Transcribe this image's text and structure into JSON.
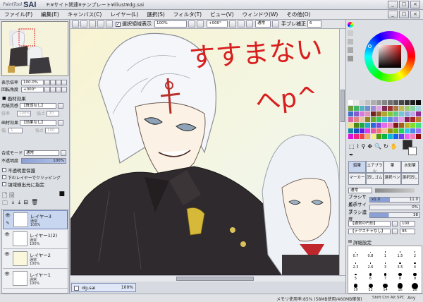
{
  "app": {
    "logo_small": "PaintTool",
    "logo_big": "SAI",
    "title": "F:¥サイト関連¥テンプレート¥illust¥dg.sai"
  },
  "window_buttons": [
    "_",
    "□",
    "×"
  ],
  "menu": [
    "ファイル(F)",
    "編集(E)",
    "キャンバス(C)",
    "レイヤー(L)",
    "選択(S)",
    "フィルタ(T)",
    "ビュー(V)",
    "ウィンドウ(W)",
    "その他(O)"
  ],
  "toolbar": {
    "selection_label": "選択領域表示",
    "zoom": "100%",
    "angle": "+000°",
    "mode": "通常",
    "stabilizer_label": "手ブレ補正",
    "stabilizer_value": "6"
  },
  "navigator": {
    "zoom_label": "表示倍率",
    "zoom_value": "100.0%",
    "rotate_label": "回転角度",
    "rotate_value": "+000°"
  },
  "paper": {
    "header": "画材効果",
    "texture_label": "用紙質感",
    "texture_value": "【質感なし】",
    "scale_label": "倍率",
    "scale_value": "100%",
    "strength_label": "強さ",
    "strength_value": "20",
    "effect_label": "画材効果",
    "effect_value": "【効果なし】",
    "width_label": "幅",
    "width_value": "1",
    "intensity_label": "強さ",
    "intensity_value": "100"
  },
  "layer_props": {
    "blend_label": "合成モード",
    "blend_value": "通常",
    "opacity_label": "不透明度",
    "opacity_value": "100%",
    "checks": [
      "不透明度保護",
      "下のレイヤーでクリッピング",
      "領域検出元に指定"
    ]
  },
  "layers": [
    {
      "name": "レイヤー3",
      "mode": "通常",
      "opacity": "100%"
    },
    {
      "name": "レイヤー1(2)",
      "mode": "通常",
      "opacity": "100%"
    },
    {
      "name": "レイヤー2",
      "mode": "通常",
      "opacity": "100%"
    },
    {
      "name": "レイヤー1",
      "mode": "通常",
      "opacity": "100%"
    }
  ],
  "canvas": {
    "handwriting_line1": "すすまない",
    "handwriting_line2": "へp^"
  },
  "doc_tab": {
    "name": "dg.sai",
    "zoom": "100%"
  },
  "status": {
    "memory": "メモリ使用率:85% (58MB使用/460MB確保)",
    "keys": "Shift Ctrl Alt SPC",
    "brand": "Any"
  },
  "tools": {
    "tabs": [
      "鉛筆",
      "エアブラシ",
      "筆",
      "水彩筆",
      "マーカー",
      "消しゴム",
      "選択ペン",
      "選択消し"
    ],
    "mode_value": "通常",
    "brush_size_label": "ブラシサイズ",
    "brush_size_mult": "x1.0",
    "brush_size_value": "11.0",
    "min_size_label": "最小サイズ",
    "min_size_value": "0%",
    "density_label": "ブラシ濃度",
    "density_value": "38",
    "shape_value": "【通常の円形】",
    "shape_strength": "100",
    "texture_value": "【テクスチャなし】",
    "texture_strength": "95",
    "detail_label": "詳細設定"
  },
  "dots": [
    "0.7",
    "0.8",
    "1",
    "1.5",
    "2",
    "2.3",
    "2.6",
    "3",
    "3.5",
    "4",
    "5",
    "6",
    "7",
    "8",
    "9",
    "10",
    "12",
    "14",
    "16",
    "20"
  ],
  "colors": {
    "accent": "#6a7fb8",
    "selected_layer": "#c9d6f0",
    "hand_red": "#d81f1f"
  }
}
